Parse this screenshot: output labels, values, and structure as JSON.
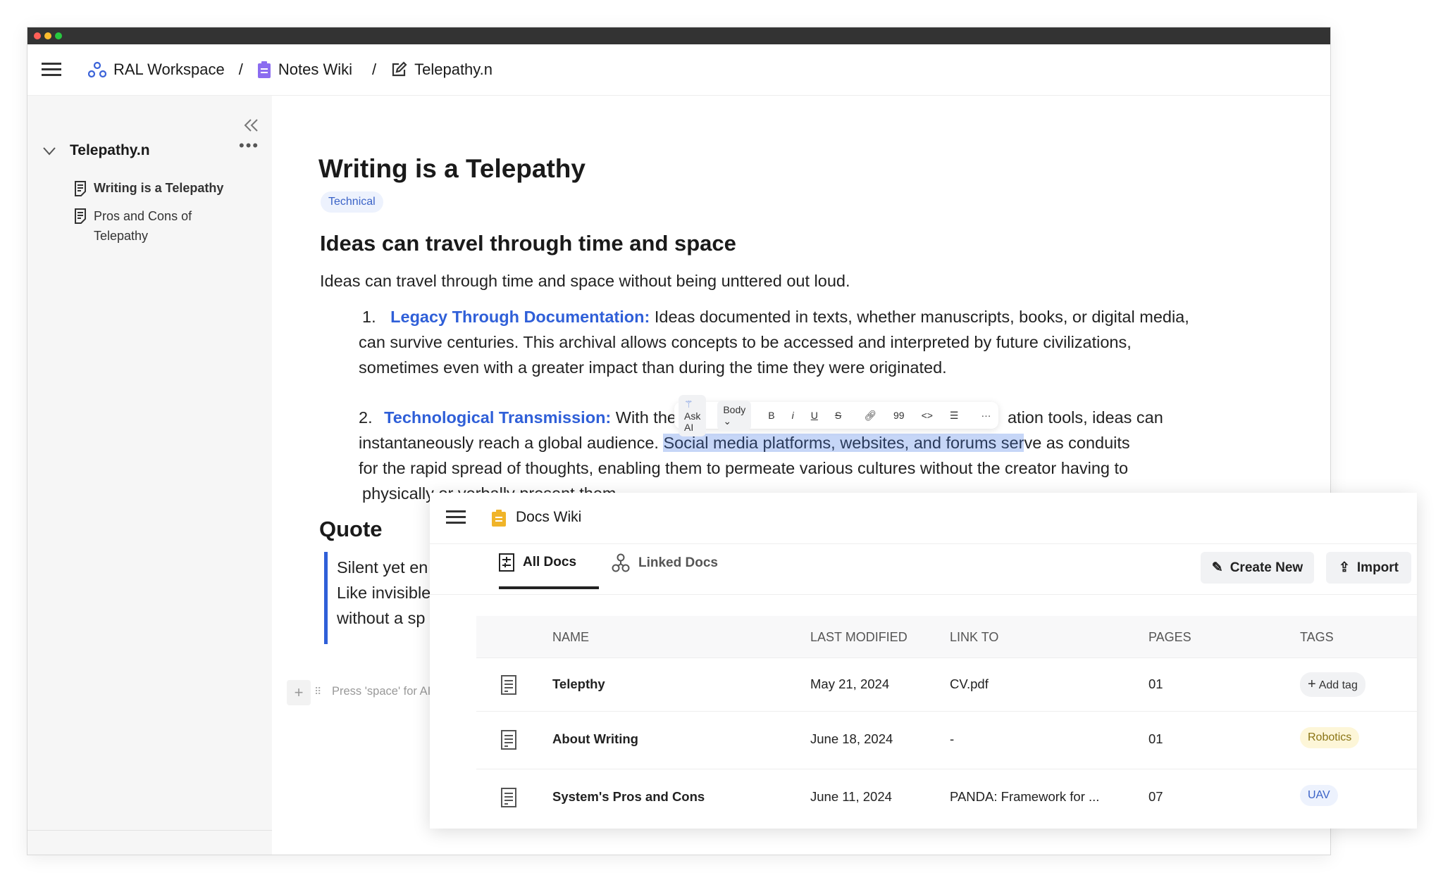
{
  "window": {
    "traffic_lights": [
      "#ff5f57",
      "#febc2e",
      "#28c840"
    ]
  },
  "header": {
    "breadcrumb": [
      {
        "label": "RAL Workspace",
        "icon": "workspace-icon"
      },
      {
        "label": "Notes Wiki",
        "icon": "clipboard-icon"
      },
      {
        "label": "Telepathy.n",
        "icon": "edit-icon"
      }
    ],
    "separator": "/"
  },
  "sidebar": {
    "folder": "Telepathy.n",
    "items": [
      {
        "label": "Writing is a Telepathy"
      },
      {
        "label": "Pros and Cons of Telepathy"
      }
    ]
  },
  "doc": {
    "title": "Writing is a Telepathy",
    "tag": "Technical",
    "heading": "Ideas can travel through time and space",
    "intro": "Ideas can travel through time and space without being unttered out loud.",
    "list": [
      {
        "num": "1.",
        "title": "Legacy Through Documentation:",
        "lines": [
          "Ideas documented in texts, whether manuscripts, books, or digital media,",
          "can survive centuries. This archival allows concepts to be accessed and interpreted by future civilizations,",
          "sometimes even with a greater impact than during the time they were originated."
        ]
      },
      {
        "num": "2.",
        "title": "Technological Transmission:",
        "line1a": "With the",
        "line1b": "ation tools, ideas can",
        "line2a": "instantaneously reach a global audience. ",
        "line2sel": "Social media platforms, websites, and forums ser",
        "line2b": "ve as conduits",
        "line3": "for the rapid spread of thoughts, enabling them to permeate various cultures without the creator having to",
        "line4": "physically or verbally present them."
      }
    ],
    "quote_heading": "Quote",
    "quote_lines": [
      "Silent yet en",
      "Like invisible",
      "without a sp"
    ],
    "placeholder": "Press 'space' for AI, '"
  },
  "toolbar": {
    "ask_ai": "Ask AI",
    "style": "Body",
    "bold": "B",
    "italic": "i",
    "underline": "U",
    "strike": "S",
    "quote": "99",
    "code": "<>",
    "more": "···"
  },
  "docs_panel": {
    "title": "Docs Wiki",
    "tabs": [
      {
        "label": "All Docs",
        "active": true
      },
      {
        "label": "Linked Docs",
        "active": false
      }
    ],
    "create_new": "Create New",
    "import": "Import",
    "columns": [
      "NAME",
      "LAST MODIFIED",
      "LINK TO",
      "PAGES",
      "TAGS"
    ],
    "rows": [
      {
        "name": "Telepthy",
        "modified": "May 21, 2024",
        "link": "CV.pdf",
        "pages": "01",
        "tag": "Add tag",
        "tag_type": "add"
      },
      {
        "name": "About Writing",
        "modified": "June 18, 2024",
        "link": "-",
        "pages": "01",
        "tag": "Robotics",
        "tag_type": "yellow"
      },
      {
        "name": "System's Pros and Cons",
        "modified": "June 11, 2024",
        "link": "PANDA: Framework for ...",
        "pages": "07",
        "tag": "UAV",
        "tag_type": "blue"
      }
    ]
  },
  "colors": {
    "accent": "#2f5fd8",
    "selection": "#c6d6f7",
    "tag_yellow": "#fdf6d8",
    "tag_blue": "#edf2fd"
  }
}
